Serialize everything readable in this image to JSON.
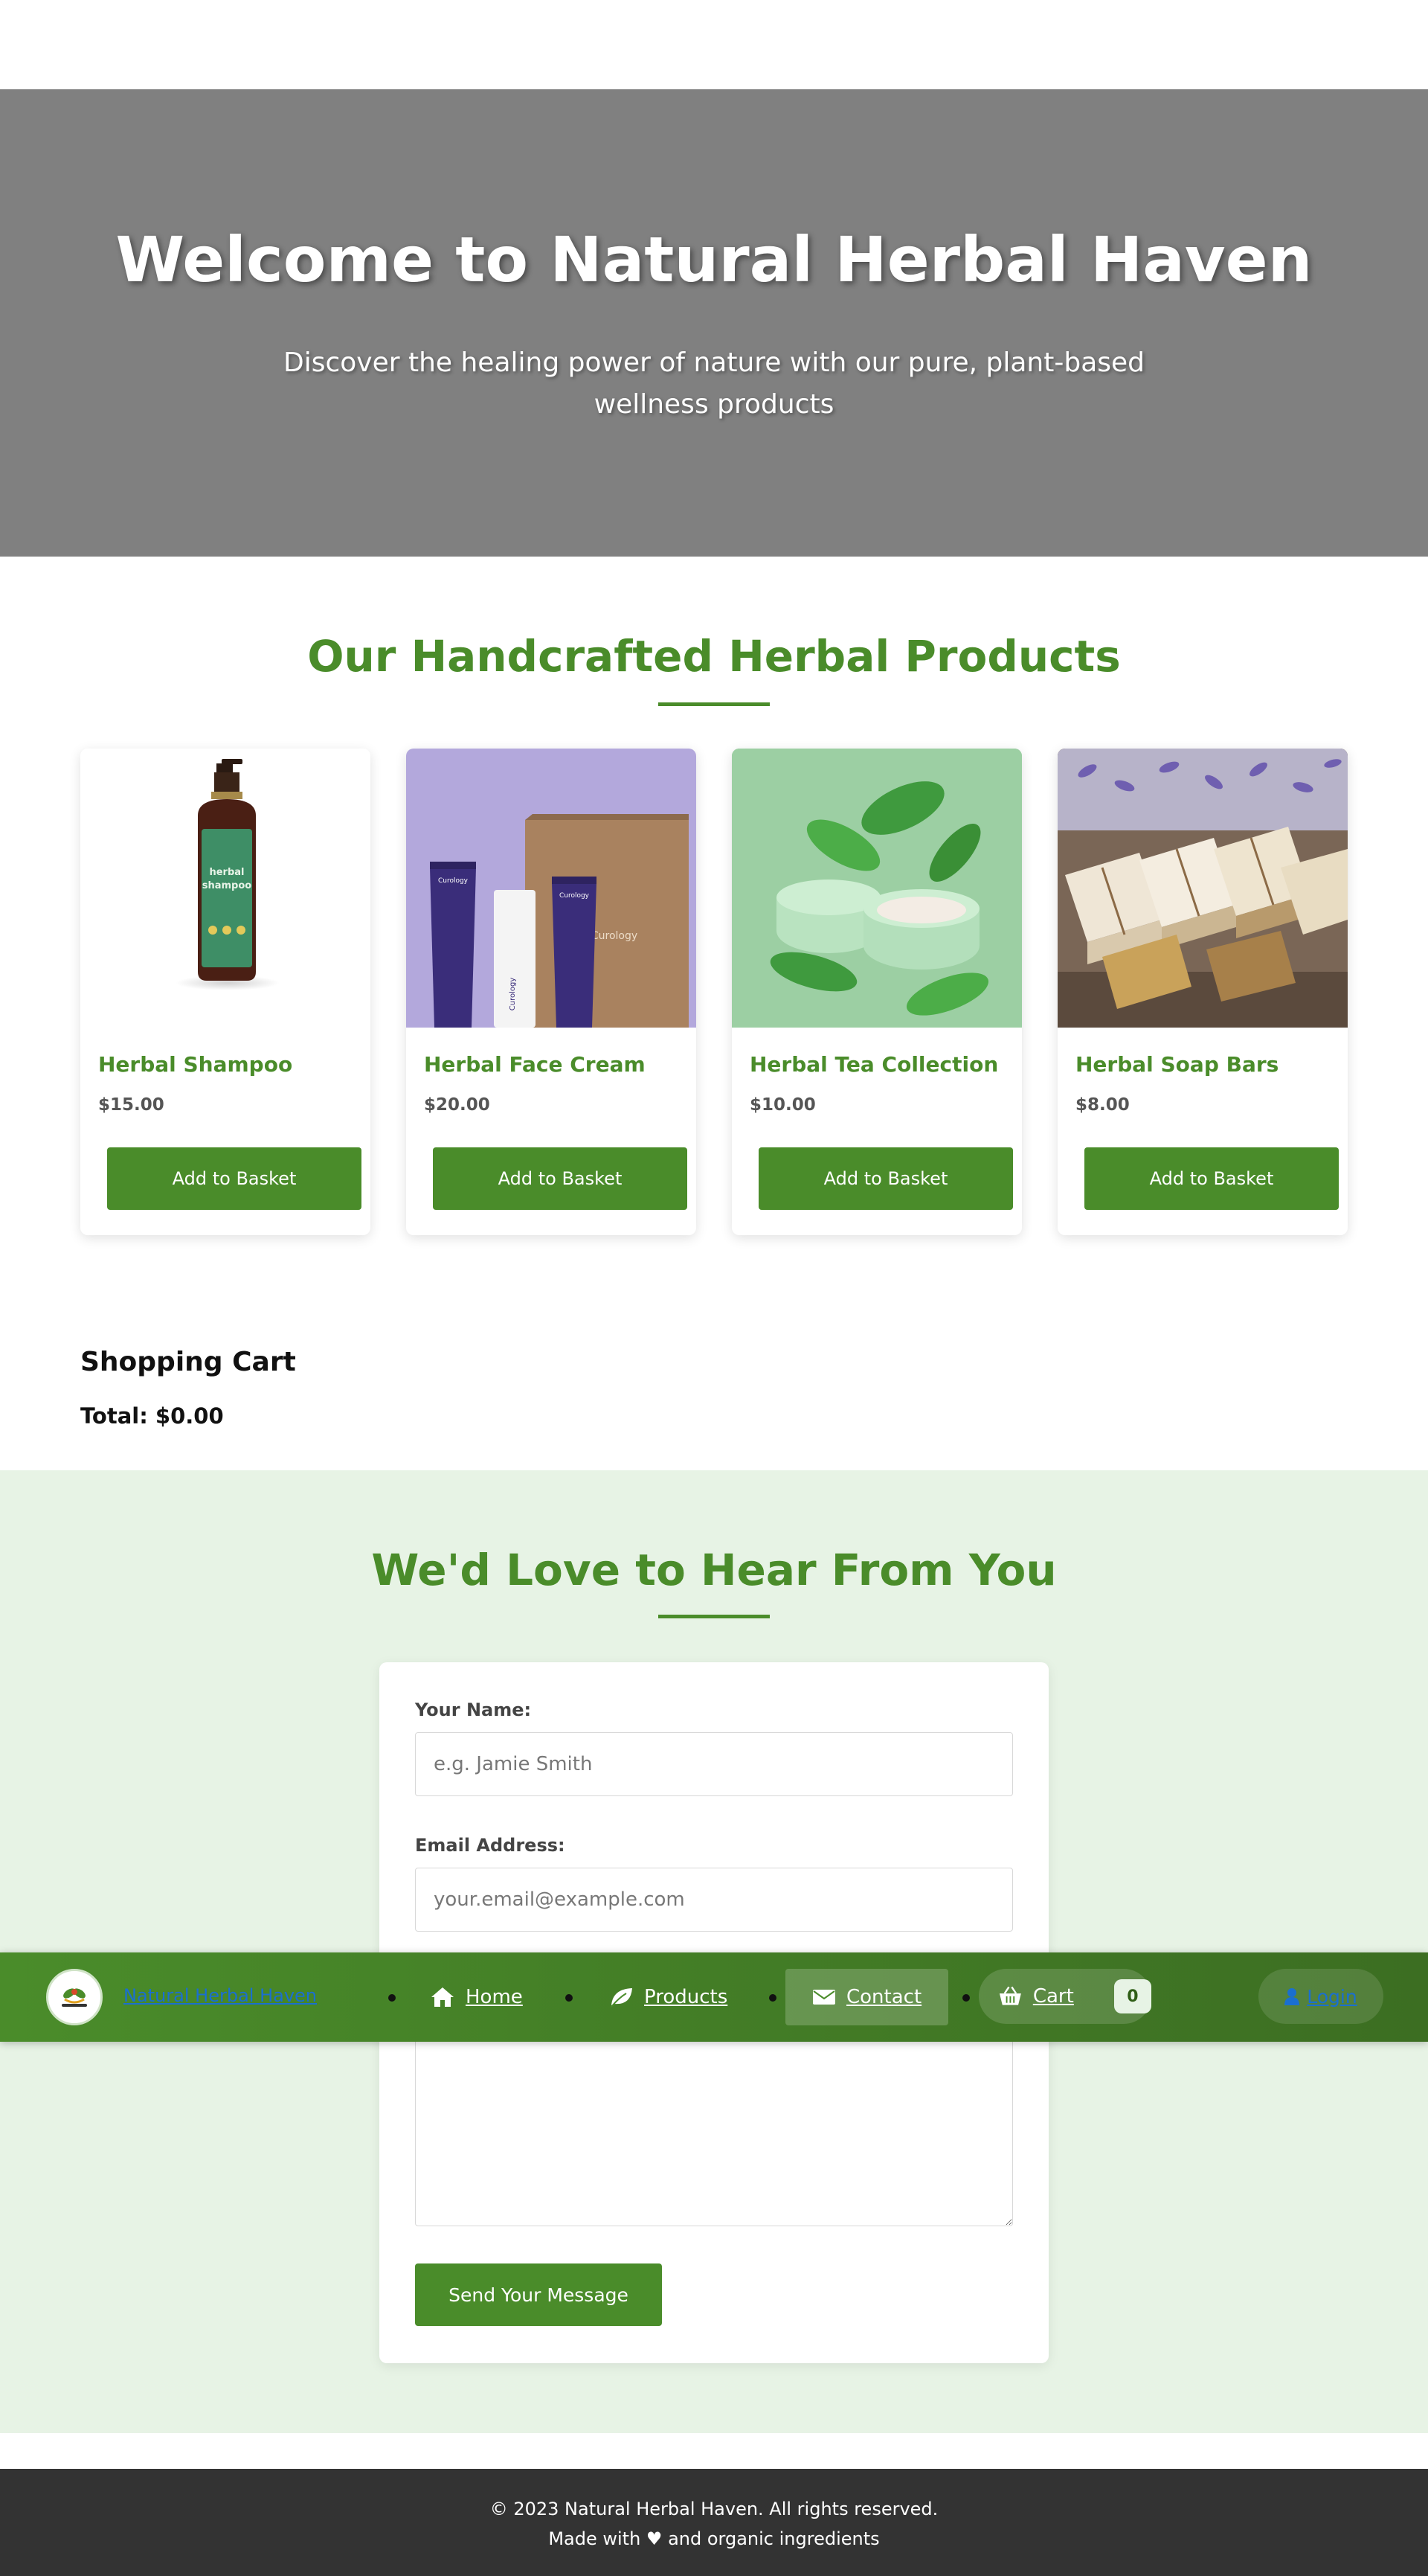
{
  "hero": {
    "title": "Welcome to Natural Herbal Haven",
    "subtitle": "Discover the healing power of nature with our pure, plant-based wellness products"
  },
  "products": {
    "heading": "Our Handcrafted Herbal Products",
    "items": [
      {
        "name": "Herbal Shampoo",
        "price": "$15.00",
        "button": "Add to Basket",
        "image_icon": "shampoo-bottle-image"
      },
      {
        "name": "Herbal Face Cream",
        "price": "$20.00",
        "button": "Add to Basket",
        "image_icon": "face-cream-image",
        "image_brand": "Curology"
      },
      {
        "name": "Herbal Tea Collection",
        "price": "$10.00",
        "button": "Add to Basket",
        "image_icon": "cream-jar-leaves-image"
      },
      {
        "name": "Herbal Soap Bars",
        "price": "$8.00",
        "button": "Add to Basket",
        "image_icon": "soap-bars-lavender-image"
      }
    ]
  },
  "cart": {
    "title": "Shopping Cart",
    "total": "Total: $0.00"
  },
  "contact": {
    "heading": "We'd Love to Hear From You",
    "name_label": "Your Name:",
    "name_placeholder": "e.g. Jamie Smith",
    "email_label": "Email Address:",
    "email_placeholder": "your.email@example.com",
    "send_button": "Send Your Message"
  },
  "navbar": {
    "logo_text": "Natural Herbal Haven",
    "items": [
      {
        "label": "Home",
        "icon": "home-icon"
      },
      {
        "label": "Products",
        "icon": "leaf-icon"
      },
      {
        "label": "Contact",
        "icon": "envelope-icon"
      }
    ],
    "cart_label": "Cart",
    "cart_count": "0",
    "login_label": "Login"
  },
  "footer": {
    "line1": "© 2023 Natural Herbal Haven. All rights reserved.",
    "line2": "Made with ♥ and organic ingredients"
  },
  "colors": {
    "brand_green": "#4a8c2a",
    "hero_gray": "#808080",
    "contact_bg": "#e7f3e5",
    "footer_bg": "#333333"
  }
}
